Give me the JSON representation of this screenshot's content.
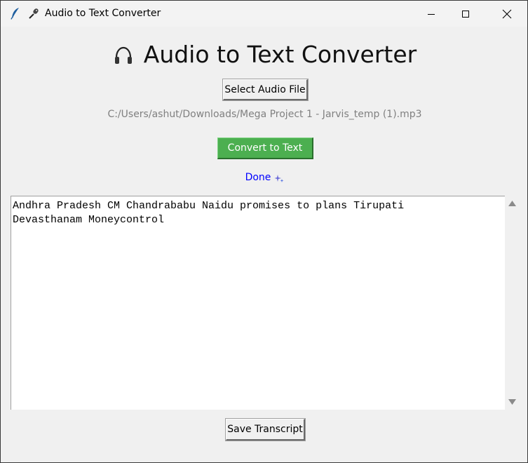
{
  "window": {
    "title": "Audio to Text Converter",
    "app_icon": "feather-icon",
    "title_icon": "microphone-icon",
    "controls": [
      "minimize-icon",
      "maximize-icon",
      "close-icon"
    ]
  },
  "main": {
    "heading_icon": "headphones-icon",
    "heading": "Audio to Text Converter",
    "select_button_label": "Select Audio File",
    "file_path": "C:/Users/ashut/Downloads/Mega Project 1 - Jarvis_temp (1).mp3",
    "convert_button_label": "Convert to Text",
    "status_text": "Done",
    "status_icon": "sparkle-icon",
    "transcript": "Andhra Pradesh CM Chandrababu Naidu promises to plans Tirupati\nDevasthanam Moneycontrol",
    "save_button_label": "Save Transcript"
  },
  "colors": {
    "convert_button_bg": "#4caf50",
    "status_text": "#0000ff",
    "file_path_text": "#808080",
    "window_bg": "#f0f0f0"
  }
}
